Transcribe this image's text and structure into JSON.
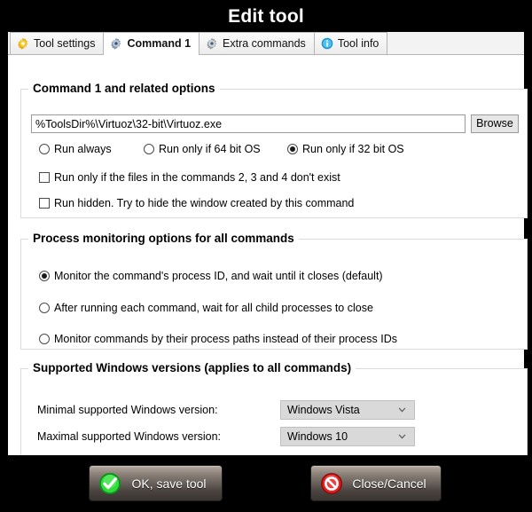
{
  "window": {
    "title": "Edit tool"
  },
  "tabs": [
    {
      "label": "Tool settings",
      "icon": "gear-yellow-icon",
      "active": false
    },
    {
      "label": "Command 1",
      "icon": "gear-blue-icon",
      "active": true
    },
    {
      "label": "Extra commands",
      "icon": "gear-gray-icon",
      "active": false
    },
    {
      "label": "Tool info",
      "icon": "info-icon",
      "active": false
    }
  ],
  "command_group": {
    "title": "Command 1 and related options",
    "path_value": "%ToolsDir%\\Virtuoz\\32-bit\\Virtuoz.exe",
    "path_placeholder": "",
    "browse_label": "Browse",
    "run_condition_options": [
      {
        "label": "Run always",
        "selected": false
      },
      {
        "label": "Run only if 64 bit OS",
        "selected": false
      },
      {
        "label": "Run only if 32 bit OS",
        "selected": true
      }
    ],
    "checkboxes": [
      {
        "label": "Run only if the files in the commands 2, 3 and 4 don't exist",
        "checked": false
      },
      {
        "label": "Run hidden. Try to hide the window created by this command",
        "checked": false
      }
    ]
  },
  "process_group": {
    "title": "Process monitoring options for all commands",
    "options": [
      {
        "label": "Monitor the command's process ID, and wait until it closes (default)",
        "selected": true
      },
      {
        "label": "After running each command, wait for all child processes to close",
        "selected": false
      },
      {
        "label": "Monitor commands by their process paths instead of their process IDs",
        "selected": false
      }
    ]
  },
  "winver_group": {
    "title": "Supported Windows versions (applies to all commands)",
    "minimal": {
      "label": "Minimal supported Windows version:",
      "value": "Windows Vista"
    },
    "maximal": {
      "label": "Maximal supported Windows version:",
      "value": "Windows 10"
    }
  },
  "footer": {
    "ok_label": "OK, save tool",
    "ok_icon": "green-check-icon",
    "close_label": "Close/Cancel",
    "close_icon": "red-prohibition-icon"
  },
  "colors": {
    "chrome_background": "#000000",
    "dialog_background": "#ffffff",
    "accent_green": "#2ecc2e",
    "accent_red": "#d42a2a",
    "tab_gear_yellow": "#f5c518",
    "tab_gear_blue": "#8aa8c8",
    "info_blue": "#2aa8e0"
  }
}
